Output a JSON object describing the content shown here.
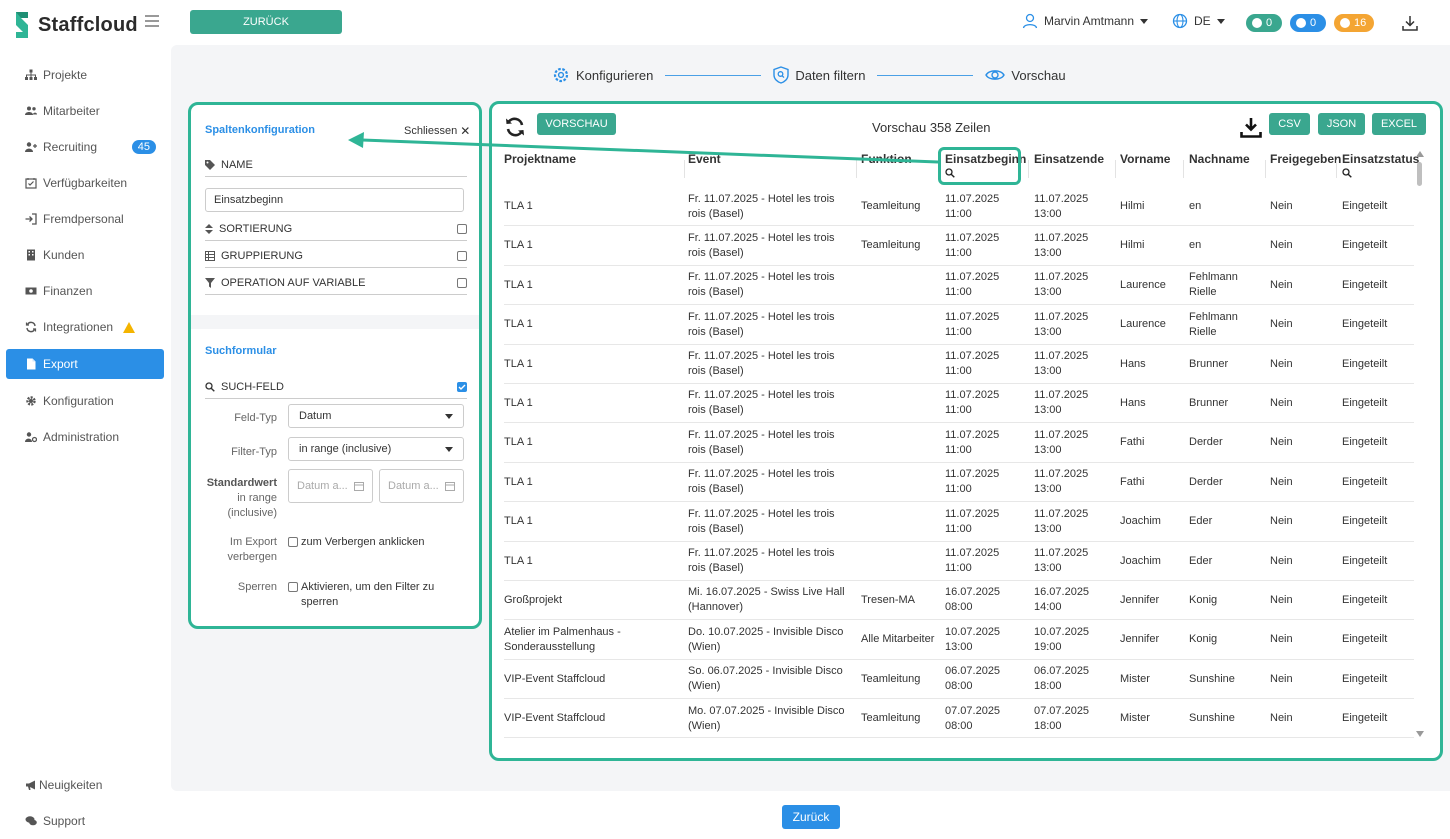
{
  "app": {
    "brand": "Staffcloud",
    "back_top": "ZURÜCK",
    "back_bottom": "Zurück"
  },
  "header": {
    "user_name": "Marvin Amtmann",
    "language": "DE",
    "badges": [
      {
        "count": "0",
        "color": "#3aa78f",
        "icon": "chat-icon"
      },
      {
        "count": "0",
        "color": "#2b8fe6",
        "icon": "bell-icon"
      },
      {
        "count": "16",
        "color": "#f4a533",
        "icon": "alert-icon"
      }
    ]
  },
  "sidebar": {
    "items": [
      {
        "label": "Projekte",
        "icon": "sitemap-icon"
      },
      {
        "label": "Mitarbeiter",
        "icon": "users-icon"
      },
      {
        "label": "Recruiting",
        "icon": "user-plus-icon",
        "badge": "45"
      },
      {
        "label": "Verfügbarkeiten",
        "icon": "calendar-check-icon"
      },
      {
        "label": "Fremdpersonal",
        "icon": "sign-in-icon"
      },
      {
        "label": "Kunden",
        "icon": "building-icon"
      },
      {
        "label": "Finanzen",
        "icon": "money-icon"
      },
      {
        "label": "Integrationen",
        "icon": "sync-icon"
      },
      {
        "label": "Export",
        "icon": "file-icon"
      },
      {
        "label": "Konfiguration",
        "icon": "gear-icon"
      },
      {
        "label": "Administration",
        "icon": "user-cog-icon"
      }
    ],
    "bottom": [
      {
        "label": "Neuigkeiten",
        "icon": "megaphone-icon"
      },
      {
        "label": "Support",
        "icon": "comments-icon"
      }
    ]
  },
  "steps": [
    {
      "label": "Konfigurieren",
      "icon": "gear-icon"
    },
    {
      "label": "Daten filtern",
      "icon": "shield-search-icon"
    },
    {
      "label": "Vorschau",
      "icon": "eye-icon"
    }
  ],
  "config": {
    "title": "Spaltenkonfiguration",
    "close": "Schliessen",
    "name_label": "NAME",
    "name_value": "Einsatzbeginn",
    "sort_label": "SORTIERUNG",
    "group_label": "GRUPPIERUNG",
    "operation_label": "OPERATION AUF VARIABLE",
    "search_title": "Suchformular",
    "search_field_label": "SUCH-FELD",
    "field_type_label": "Feld-Typ",
    "field_type_value": "Datum",
    "filter_type_label": "Filter-Typ",
    "filter_type_value": "in range (inclusive)",
    "default_label": "Standardwert",
    "default_sub": "in range (inclusive)",
    "date_placeholder": "Datum a...",
    "hide_label": "Im Export verbergen",
    "hide_text": "zum Verbergen anklicken",
    "lock_label": "Sperren",
    "lock_text": "Aktivieren, um den Filter zu sperren"
  },
  "preview": {
    "preview_button": "VORSCHAU",
    "title": "Vorschau 358 Zeilen",
    "export_buttons": [
      "CSV",
      "JSON",
      "EXCEL"
    ],
    "columns": [
      "Projektname",
      "Event",
      "Funktion",
      "Einsatzbeginn",
      "Einsatzende",
      "Vorname",
      "Nachname",
      "Freigegeben",
      "Einsatzstatus"
    ],
    "rows": [
      [
        "TLA 1",
        "Fr. 11.07.2025 - Hotel les trois rois (Basel)",
        "Teamleitung",
        "11.07.2025 11:00",
        "11.07.2025 13:00",
        "Hilmi",
        "en",
        "Nein",
        "Eingeteilt"
      ],
      [
        "TLA 1",
        "Fr. 11.07.2025 - Hotel les trois rois (Basel)",
        "Teamleitung",
        "11.07.2025 11:00",
        "11.07.2025 13:00",
        "Hilmi",
        "en",
        "Nein",
        "Eingeteilt"
      ],
      [
        "TLA 1",
        "Fr. 11.07.2025 - Hotel les trois rois (Basel)",
        "",
        "11.07.2025 11:00",
        "11.07.2025 13:00",
        "Laurence",
        "Fehlmann Rielle",
        "Nein",
        "Eingeteilt"
      ],
      [
        "TLA 1",
        "Fr. 11.07.2025 - Hotel les trois rois (Basel)",
        "",
        "11.07.2025 11:00",
        "11.07.2025 13:00",
        "Laurence",
        "Fehlmann Rielle",
        "Nein",
        "Eingeteilt"
      ],
      [
        "TLA 1",
        "Fr. 11.07.2025 - Hotel les trois rois (Basel)",
        "",
        "11.07.2025 11:00",
        "11.07.2025 13:00",
        "Hans",
        "Brunner",
        "Nein",
        "Eingeteilt"
      ],
      [
        "TLA 1",
        "Fr. 11.07.2025 - Hotel les trois rois (Basel)",
        "",
        "11.07.2025 11:00",
        "11.07.2025 13:00",
        "Hans",
        "Brunner",
        "Nein",
        "Eingeteilt"
      ],
      [
        "TLA 1",
        "Fr. 11.07.2025 - Hotel les trois rois (Basel)",
        "",
        "11.07.2025 11:00",
        "11.07.2025 13:00",
        "Fathi",
        "Derder",
        "Nein",
        "Eingeteilt"
      ],
      [
        "TLA 1",
        "Fr. 11.07.2025 - Hotel les trois rois (Basel)",
        "",
        "11.07.2025 11:00",
        "11.07.2025 13:00",
        "Fathi",
        "Derder",
        "Nein",
        "Eingeteilt"
      ],
      [
        "TLA 1",
        "Fr. 11.07.2025 - Hotel les trois rois (Basel)",
        "",
        "11.07.2025 11:00",
        "11.07.2025 13:00",
        "Joachim",
        "Eder",
        "Nein",
        "Eingeteilt"
      ],
      [
        "TLA 1",
        "Fr. 11.07.2025 - Hotel les trois rois (Basel)",
        "",
        "11.07.2025 11:00",
        "11.07.2025 13:00",
        "Joachim",
        "Eder",
        "Nein",
        "Eingeteilt"
      ],
      [
        "Großprojekt",
        "Mi. 16.07.2025 - Swiss Live Hall (Hannover)",
        "Tresen-MA",
        "16.07.2025 08:00",
        "16.07.2025 14:00",
        "Jennifer",
        "Konig",
        "Nein",
        "Eingeteilt"
      ],
      [
        "Atelier im Palmenhaus - Sonderausstellung",
        "Do. 10.07.2025 - Invisible Disco (Wien)",
        "Alle Mitarbeiter",
        "10.07.2025 13:00",
        "10.07.2025 19:00",
        "Jennifer",
        "Konig",
        "Nein",
        "Eingeteilt"
      ],
      [
        "VIP-Event Staffcloud",
        "So. 06.07.2025 - Invisible Disco (Wien)",
        "Teamleitung",
        "06.07.2025 08:00",
        "06.07.2025 18:00",
        "Mister",
        "Sunshine",
        "Nein",
        "Eingeteilt"
      ],
      [
        "VIP-Event Staffcloud",
        "Mo. 07.07.2025 - Invisible Disco (Wien)",
        "Teamleitung",
        "07.07.2025 08:00",
        "07.07.2025 18:00",
        "Mister",
        "Sunshine",
        "Nein",
        "Eingeteilt"
      ]
    ]
  },
  "colors": {
    "accent_green": "#3aa78f",
    "accent_blue": "#2b8fe6",
    "highlight": "#2fb596",
    "warning": "#f4b400"
  }
}
